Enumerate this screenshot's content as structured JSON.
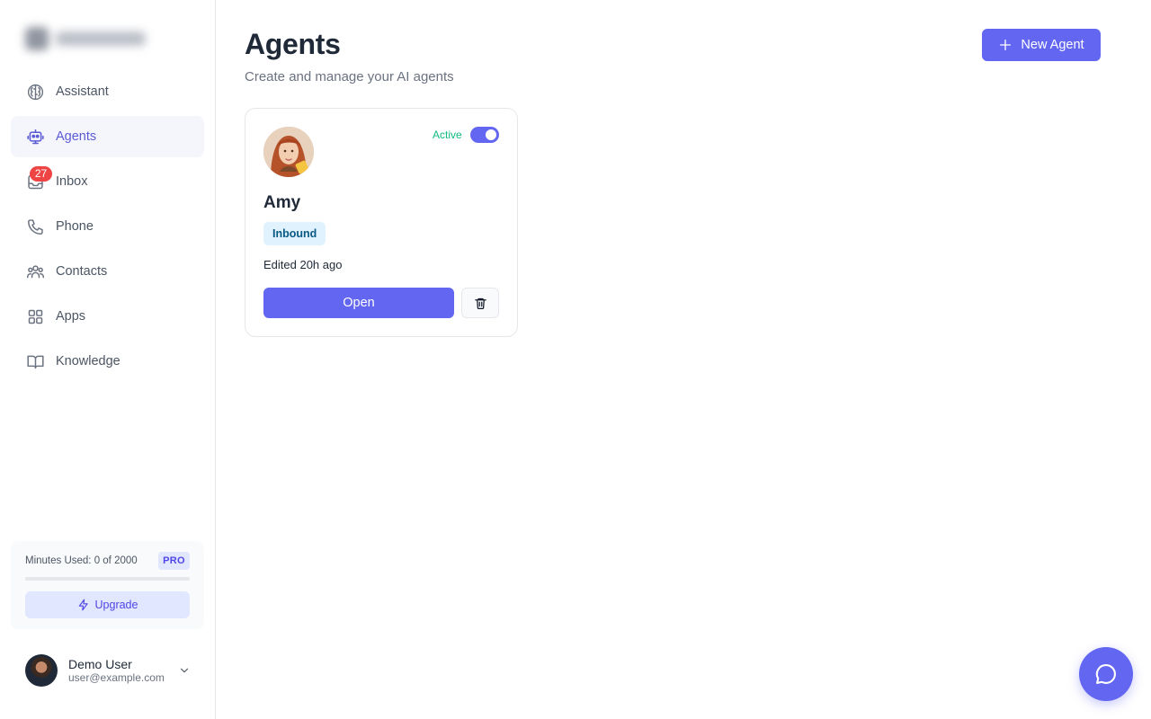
{
  "sidebar": {
    "items": [
      {
        "label": "Assistant",
        "icon": "brain-icon"
      },
      {
        "label": "Agents",
        "icon": "robot-icon",
        "active": true
      },
      {
        "label": "Inbox",
        "icon": "inbox-icon",
        "badge": "27"
      },
      {
        "label": "Phone",
        "icon": "phone-icon"
      },
      {
        "label": "Contacts",
        "icon": "users-icon"
      },
      {
        "label": "Apps",
        "icon": "grid-icon"
      },
      {
        "label": "Knowledge",
        "icon": "book-icon"
      }
    ],
    "usage": {
      "label": "Minutes Used: 0 of 2000",
      "plan": "PRO",
      "used_fraction": 0,
      "upgrade_label": "Upgrade"
    },
    "user": {
      "name": "Demo User",
      "email": "user@example.com"
    }
  },
  "header": {
    "title": "Agents",
    "subtitle": "Create and manage your AI agents",
    "new_agent_label": "New Agent"
  },
  "agents": [
    {
      "name": "Amy",
      "status_label": "Active",
      "enabled": true,
      "type": "Inbound",
      "edited": "Edited 20h ago",
      "open_label": "Open"
    }
  ],
  "colors": {
    "accent": "#6366f1",
    "active_green": "#10b981",
    "badge_red": "#ef4444"
  }
}
